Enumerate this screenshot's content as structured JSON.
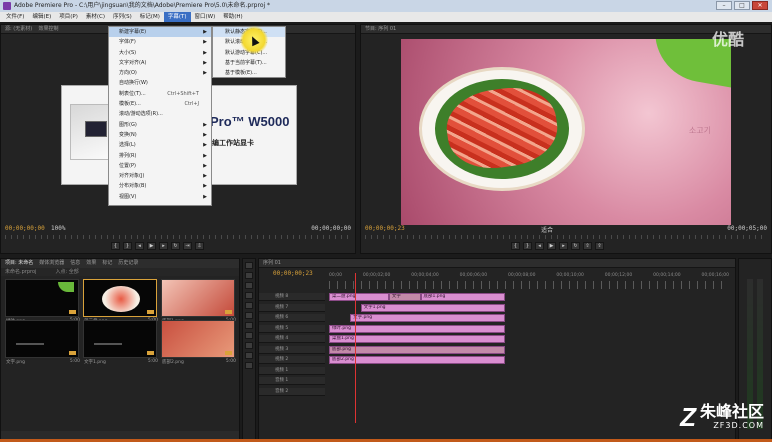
{
  "window": {
    "title": "Adobe Premiere Pro - C:\\用户\\jingsuan\\我的文档\\Adobe\\Premiere Pro\\5.0\\未命名.prproj *",
    "buttons": [
      "–",
      "□",
      "✕"
    ]
  },
  "menubar": [
    "文件(F)",
    "编辑(E)",
    "项目(P)",
    "素材(C)",
    "序列(S)",
    "标记(M)",
    "字幕(T)",
    "窗口(W)",
    "帮助(H)"
  ],
  "active_menu_index": 6,
  "title_menu": {
    "items": [
      {
        "label": "新建字幕(E)",
        "shortcut": "",
        "arrow": "▶"
      },
      {
        "label": "字体(F)",
        "shortcut": "",
        "arrow": "▶"
      },
      {
        "label": "大小(S)",
        "shortcut": "",
        "arrow": "▶"
      },
      {
        "label": "文字对齐(A)",
        "shortcut": "",
        "arrow": "▶"
      },
      {
        "label": "方向(O)",
        "shortcut": "",
        "arrow": "▶"
      },
      {
        "label": "自动换行(W)",
        "shortcut": "",
        "arrow": ""
      },
      {
        "label": "制表位(T)...",
        "shortcut": "Ctrl+Shift+T",
        "arrow": ""
      },
      {
        "label": "模板(E)...",
        "shortcut": "Ctrl+J",
        "arrow": ""
      },
      {
        "label": "滚动/游动选项(R)...",
        "shortcut": "",
        "arrow": ""
      },
      {
        "label": "图形(G)",
        "shortcut": "",
        "arrow": "▶"
      },
      {
        "label": "变换(N)",
        "shortcut": "",
        "arrow": "▶"
      },
      {
        "label": "选择(L)",
        "shortcut": "",
        "arrow": "▶"
      },
      {
        "label": "排列(R)",
        "shortcut": "",
        "arrow": "▶"
      },
      {
        "label": "位置(P)",
        "shortcut": "",
        "arrow": "▶"
      },
      {
        "label": "对齐对象(J)",
        "shortcut": "",
        "arrow": "▶"
      },
      {
        "label": "分布对象(B)",
        "shortcut": "",
        "arrow": "▶"
      },
      {
        "label": "视图(V)",
        "shortcut": "",
        "arrow": "▶"
      }
    ],
    "submenu": [
      "默认静态字幕(S)...",
      "默认滚动字幕(R)...",
      "默认游动字幕(C)...",
      "基于当前字幕(T)...",
      "基于模板(E)..."
    ]
  },
  "source_monitor": {
    "tab": "源: (无素材)",
    "tab2": "效果控制",
    "card_title": "Pro™ W5000",
    "card_subtitle": "编工作站显卡",
    "timecode_in": "00;00;00;00",
    "timecode_out": "00;00;00;00",
    "zoom": "100%"
  },
  "program_monitor": {
    "tab": "节目: 序列 01",
    "timecode_in": "00;00;00;23",
    "timecode_out": "00;00;05;00",
    "korean_text": "소고기",
    "zoom": "适合"
  },
  "project_panel": {
    "tabs": [
      "项目: 未命名",
      "媒体浏览器",
      "信息",
      "效果",
      "标记",
      "历史记录"
    ],
    "active_tab": 0,
    "bin_label": "未命名.prproj",
    "bin_info": "入点: 全部",
    "items": [
      {
        "name": "绿叶.png",
        "dur": "5:00",
        "style": "leafy"
      },
      {
        "name": "菜二盘.png",
        "dur": "5:00",
        "style": "food"
      },
      {
        "name": "底部1.png",
        "dur": "5:00",
        "style": "grad"
      },
      {
        "name": "文字.png",
        "dur": "5:00",
        "style": "tiny"
      },
      {
        "name": "文字1.png",
        "dur": "5:00",
        "style": "tiny"
      },
      {
        "name": "底部2.png",
        "dur": "5:00",
        "style": "peach"
      }
    ]
  },
  "timeline": {
    "tab": "序列 01",
    "timecode": "00;00;00;23",
    "ticks": [
      "00;00",
      "00;00;02;00",
      "00;00;04;00",
      "00;00;06;00",
      "00;00;08;00",
      "00;00;10;00",
      "00;00;12;00",
      "00;00;14;00",
      "00;00;16;00"
    ],
    "tracks": [
      {
        "name": "视频 8",
        "clips": [
          {
            "label": "菜二盘.png",
            "start": 0,
            "end": 34,
            "sel": false
          },
          {
            "label": "文字",
            "start": 34,
            "end": 52,
            "sel": true
          },
          {
            "label": "底部1.png",
            "start": 52,
            "end": 100,
            "sel": false
          }
        ]
      },
      {
        "name": "视频 7",
        "clips": [
          {
            "label": "文字1.png",
            "start": 18,
            "end": 100,
            "sel": false
          }
        ]
      },
      {
        "name": "视频 6",
        "clips": [
          {
            "label": "文字.png",
            "start": 12,
            "end": 100,
            "sel": false
          }
        ]
      },
      {
        "name": "视频 5",
        "clips": [
          {
            "label": "绿叶.png",
            "start": 0,
            "end": 100,
            "sel": false
          }
        ]
      },
      {
        "name": "视频 4",
        "clips": [
          {
            "label": "菜盘1.png",
            "start": 0,
            "end": 100,
            "sel": false
          }
        ]
      },
      {
        "name": "视频 3",
        "clips": [
          {
            "label": "底部.png",
            "start": 0,
            "end": 100,
            "sel": true
          }
        ]
      },
      {
        "name": "视频 2",
        "clips": [
          {
            "label": "底部2.png",
            "start": 0,
            "end": 100,
            "sel": false
          }
        ]
      },
      {
        "name": "视频 1",
        "clips": []
      },
      {
        "name": "音频 1",
        "clips": []
      },
      {
        "name": "音频 2",
        "clips": []
      }
    ]
  },
  "watermarks": {
    "top": "优酷",
    "brand_cn": "朱峰社区",
    "brand_en": "ZF3D.COM"
  }
}
